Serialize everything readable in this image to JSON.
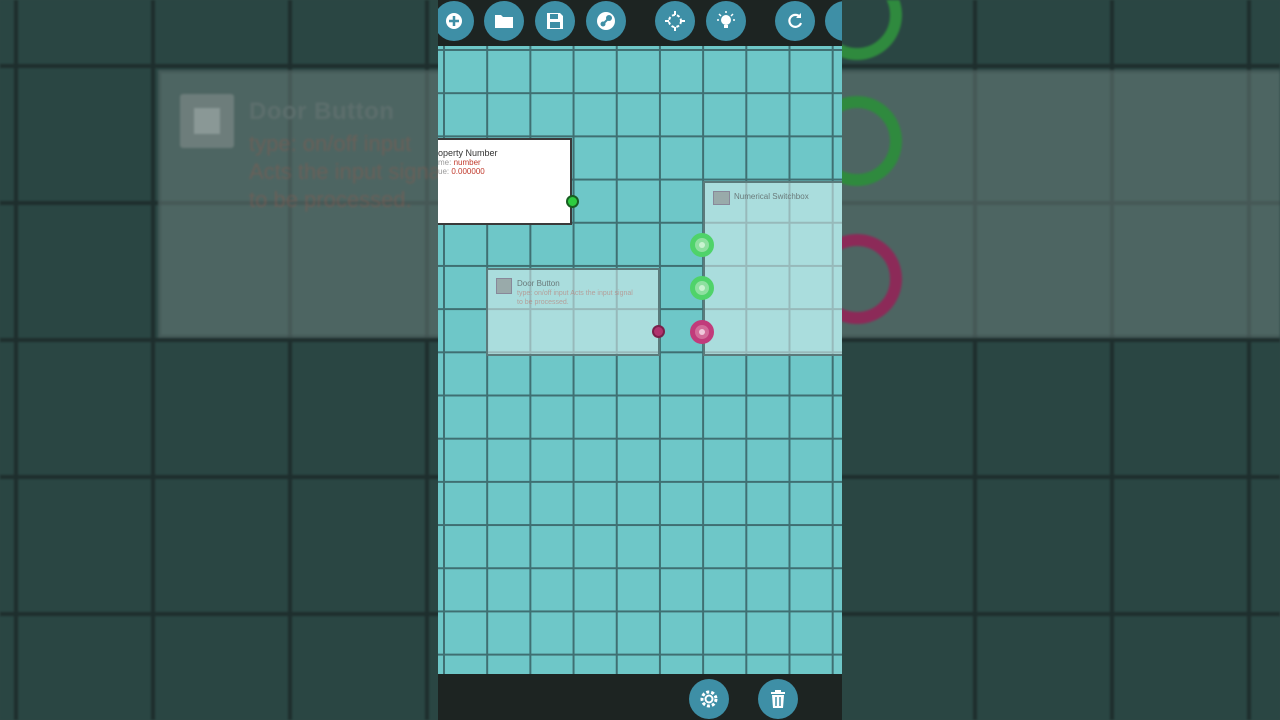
{
  "background": {
    "node_title": "Door Button",
    "node_subtitle": "type: on/off input Acts the input signal to be processed."
  },
  "toolbar": {
    "buttons": [
      {
        "name": "add",
        "icon": "plus-icon"
      },
      {
        "name": "open",
        "icon": "folder-icon"
      },
      {
        "name": "save",
        "icon": "save-icon"
      },
      {
        "name": "steam",
        "icon": "steam-icon"
      },
      {
        "name": "center",
        "icon": "focus-icon"
      },
      {
        "name": "hint",
        "icon": "lightbulb-icon"
      },
      {
        "name": "reset",
        "icon": "refresh-icon"
      }
    ]
  },
  "nodes": {
    "property_number": {
      "title": "operty Number",
      "name_label": "me: ",
      "name_value": "number",
      "value_label": "ue: ",
      "value_value": "0.000000"
    },
    "door_button": {
      "title": "Door Button",
      "subtitle": "type: on/off input Acts the input signal to be processed."
    },
    "numerical_switchbox": {
      "title": "Numerical Switchbox"
    }
  },
  "bottombar": {
    "buttons": [
      {
        "name": "settings",
        "icon": "gear-icon"
      },
      {
        "name": "delete",
        "icon": "trash-icon"
      }
    ]
  },
  "colors": {
    "canvas": "#6ec7c8",
    "grid": "#3f6f72",
    "toolbar_button": "#3e8fa6",
    "port_green": "#2ecc40",
    "port_pink": "#c13b7b"
  }
}
